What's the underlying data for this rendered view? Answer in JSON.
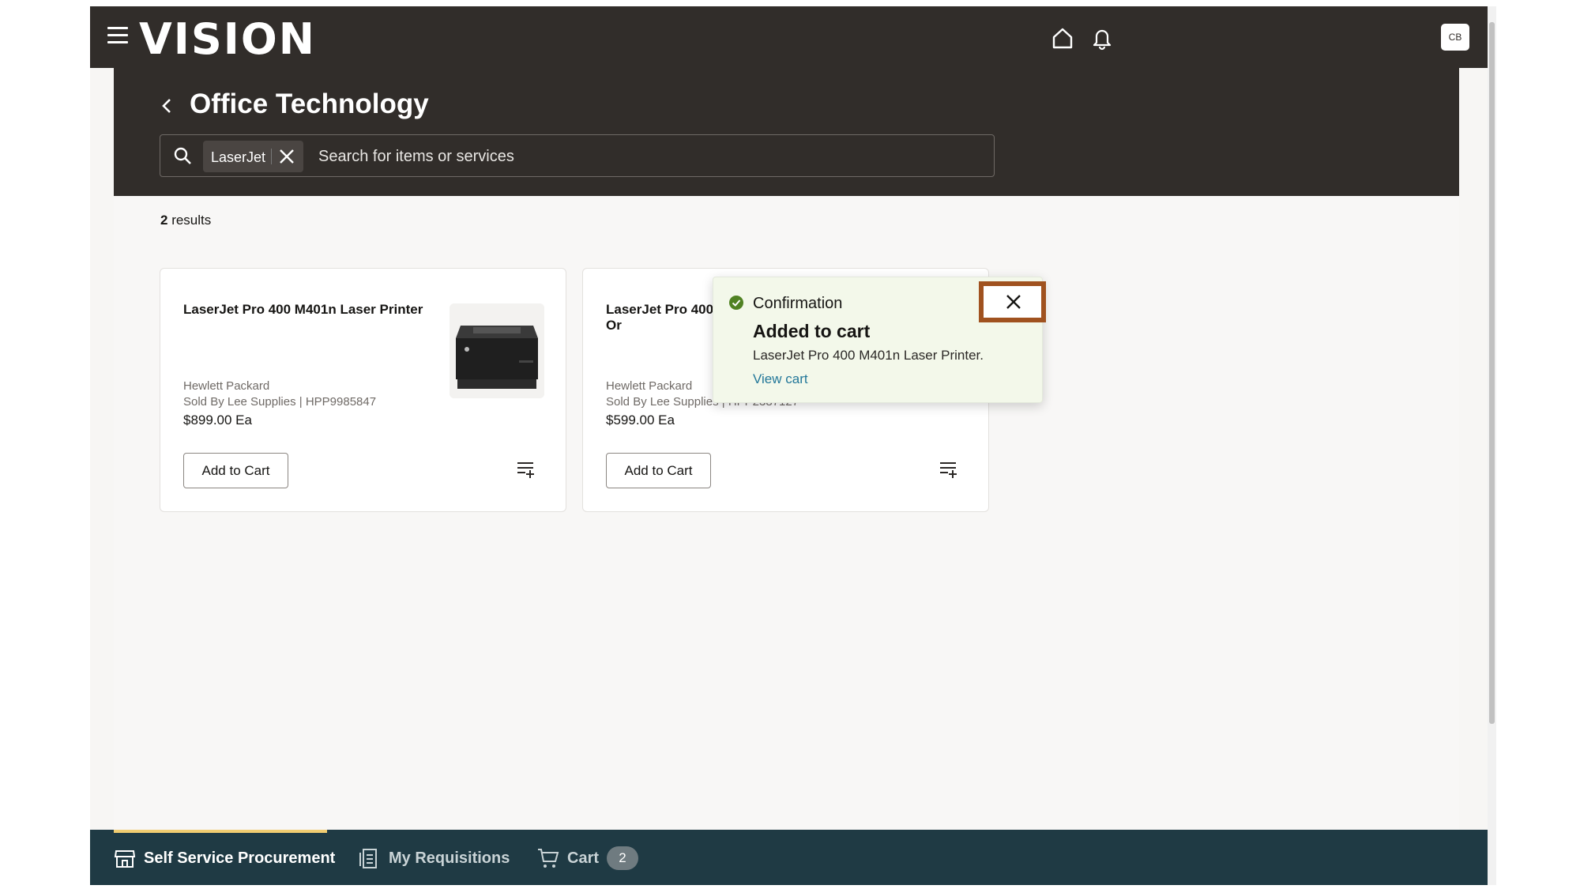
{
  "topbar": {
    "logo": "VISION",
    "avatar_initials": "CB"
  },
  "header": {
    "title": "Office Technology",
    "search": {
      "chip_label": "LaserJet",
      "placeholder": "Search for items or services"
    }
  },
  "results": {
    "count": "2",
    "label": " results"
  },
  "cards": [
    {
      "title": "LaserJet Pro 400 M401n Laser Printer",
      "brand": "Hewlett Packard",
      "sold_by": "Sold By Lee Supplies | HPP9985847",
      "price": "$899.00 Ea",
      "add_label": "Add to Cart"
    },
    {
      "title": "LaserJet Pro 400 M401n Laser Printer Or",
      "brand": "Hewlett Packard",
      "sold_by": "Sold By Lee Supplies | HPP2387127",
      "price": "$599.00 Ea",
      "add_label": "Add to Cart"
    }
  ],
  "toast": {
    "heading": "Confirmation",
    "title": "Added to cart",
    "message": "LaserJet Pro 400 M401n Laser Printer.",
    "link": "View cart"
  },
  "bottomnav": {
    "items": [
      {
        "label": "Self Service Procurement",
        "icon": "store-icon"
      },
      {
        "label": "My Requisitions",
        "icon": "requisitions-icon"
      },
      {
        "label": "Cart",
        "icon": "cart-icon"
      }
    ],
    "cart_count": "2"
  },
  "colors": {
    "topbar": "#312d2a",
    "bottomnav": "#1f3a44",
    "accent": "#f0cc71",
    "toast_bg": "#f3f8ea",
    "highlight": "#a0521f",
    "success": "#508223"
  }
}
